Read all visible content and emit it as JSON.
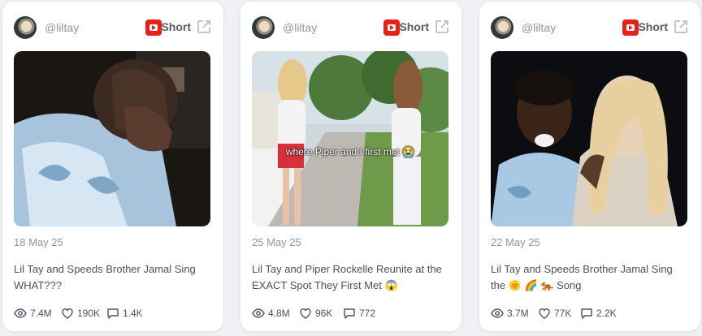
{
  "cards": [
    {
      "handle": "@liltay",
      "platform_label": "Short",
      "date": "18 May 25",
      "title": "Lil Tay and Speeds Brother Jamal Sing WHAT???",
      "views": "7.4M",
      "likes": "190K",
      "comments": "1.4K"
    },
    {
      "handle": "@liltay",
      "platform_label": "Short",
      "date": "25 May 25",
      "title": "Lil Tay and Piper Rockelle Reunite at the EXACT Spot They First Met 😱",
      "caption": "where Piper and I first met 😭",
      "views": "4.8M",
      "likes": "96K",
      "comments": "772"
    },
    {
      "handle": "@liltay",
      "platform_label": "Short",
      "date": "22 May 25",
      "title": "Lil Tay and Speeds Brother Jamal Sing the 🌞 🌈 🐅 Song",
      "views": "3.7M",
      "likes": "77K",
      "comments": "2.2K"
    }
  ],
  "icons": {
    "platform": "youtube-icon",
    "external": "external-link-icon",
    "views": "eye-icon",
    "likes": "heart-icon",
    "comments": "comment-icon"
  },
  "colors": {
    "youtube_red": "#e62117",
    "text_muted": "#8e96a3",
    "text_body": "#4a5260"
  }
}
